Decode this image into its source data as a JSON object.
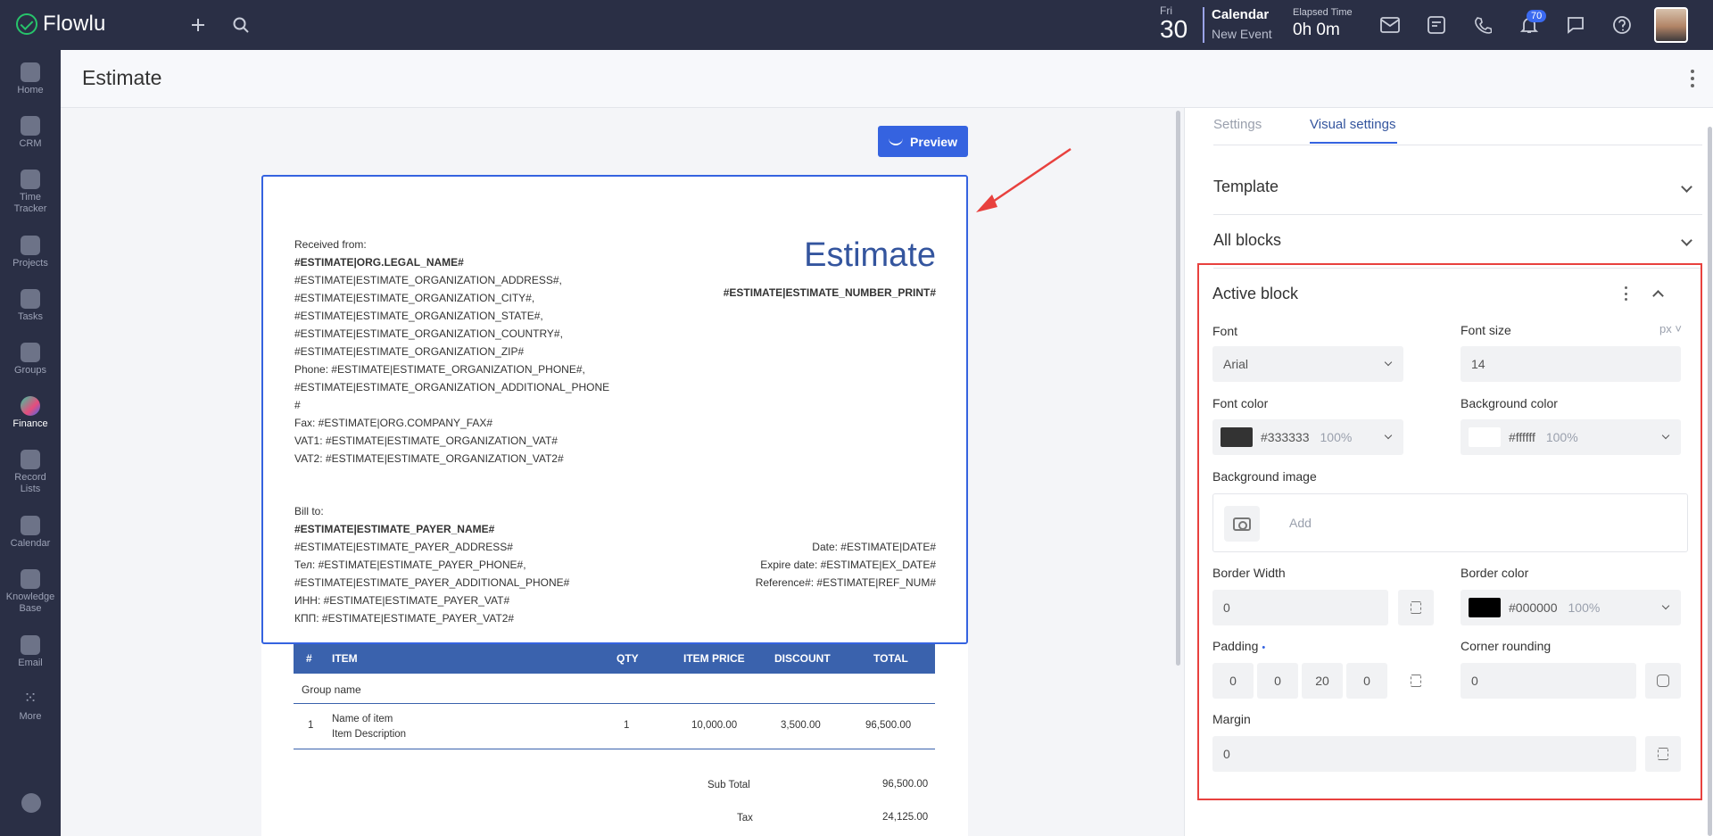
{
  "app": {
    "name": "Flowlu"
  },
  "topbar": {
    "day_name": "Fri",
    "day_num": "30",
    "calendar_title": "Calendar",
    "calendar_sub": "New Event",
    "elapsed_label": "Elapsed Time",
    "elapsed_value": "0h 0m",
    "notif_count": "70"
  },
  "sidebar": {
    "items": [
      {
        "label": "Home"
      },
      {
        "label": "CRM"
      },
      {
        "label": "Time Tracker"
      },
      {
        "label": "Projects"
      },
      {
        "label": "Tasks"
      },
      {
        "label": "Groups"
      },
      {
        "label": "Finance"
      },
      {
        "label": "Record Lists"
      },
      {
        "label": "Calendar"
      },
      {
        "label": "Knowledge Base"
      },
      {
        "label": "Email"
      },
      {
        "label": "More"
      }
    ]
  },
  "page": {
    "title": "Estimate",
    "preview_label": "Preview"
  },
  "document": {
    "title": "Estimate",
    "number": "#ESTIMATE|ESTIMATE_NUMBER_PRINT#",
    "received_from": [
      "Received from:",
      "#ESTIMATE|ORG.LEGAL_NAME#",
      "#ESTIMATE|ESTIMATE_ORGANIZATION_ADDRESS#,",
      "#ESTIMATE|ESTIMATE_ORGANIZATION_CITY#,",
      "#ESTIMATE|ESTIMATE_ORGANIZATION_STATE#,",
      "#ESTIMATE|ESTIMATE_ORGANIZATION_COUNTRY#,",
      "#ESTIMATE|ESTIMATE_ORGANIZATION_ZIP#",
      "Phone: #ESTIMATE|ESTIMATE_ORGANIZATION_PHONE#,",
      "#ESTIMATE|ESTIMATE_ORGANIZATION_ADDITIONAL_PHONE",
      "#",
      "Fax: #ESTIMATE|ORG.COMPANY_FAX#",
      "VAT1: #ESTIMATE|ESTIMATE_ORGANIZATION_VAT#",
      "VAT2: #ESTIMATE|ESTIMATE_ORGANIZATION_VAT2#"
    ],
    "bill_to": [
      "Bill to:",
      "#ESTIMATE|ESTIMATE_PAYER_NAME#",
      "#ESTIMATE|ESTIMATE_PAYER_ADDRESS#",
      "Тел: #ESTIMATE|ESTIMATE_PAYER_PHONE#,",
      "#ESTIMATE|ESTIMATE_PAYER_ADDITIONAL_PHONE#",
      "ИНН: #ESTIMATE|ESTIMATE_PAYER_VAT#",
      "КПП: #ESTIMATE|ESTIMATE_PAYER_VAT2#"
    ],
    "dates": [
      "Date: #ESTIMATE|DATE#",
      "Expire date: #ESTIMATE|EX_DATE#",
      "Reference#: #ESTIMATE|REF_NUM#"
    ],
    "table": {
      "headers": [
        "#",
        "ITEM",
        "QTY",
        "ITEM PRICE",
        "DISCOUNT",
        "TOTAL"
      ],
      "group_name": "Group name",
      "rows": [
        {
          "num": "1",
          "name": "Name of item",
          "desc": "Item Description",
          "qty": "1",
          "price": "10,000.00",
          "discount": "3,500.00",
          "total": "96,500.00"
        }
      ]
    },
    "totals": [
      {
        "label": "Sub Total",
        "value": "96,500.00"
      },
      {
        "label": "Tax",
        "value": "24,125.00"
      }
    ]
  },
  "panel": {
    "tabs": [
      {
        "label": "Settings"
      },
      {
        "label": "Visual settings"
      }
    ],
    "sections": {
      "template": "Template",
      "all_blocks": "All blocks",
      "active_block": "Active block"
    },
    "font": {
      "label": "Font",
      "value": "Arial"
    },
    "font_size": {
      "label": "Font size",
      "unit": "px",
      "value": "14"
    },
    "font_color": {
      "label": "Font color",
      "hex": "#333333",
      "opacity": "100%",
      "swatch": "#333333"
    },
    "background_color": {
      "label": "Background color",
      "hex": "#ffffff",
      "opacity": "100%",
      "swatch": "#ffffff"
    },
    "background_image": {
      "label": "Background image",
      "add_label": "Add"
    },
    "border_width": {
      "label": "Border Width",
      "value": "0"
    },
    "border_color": {
      "label": "Border color",
      "hex": "#000000",
      "opacity": "100%",
      "swatch": "#000000"
    },
    "padding": {
      "label": "Padding",
      "marker": "•",
      "values": [
        "0",
        "0",
        "20",
        "0"
      ]
    },
    "corner_rounding": {
      "label": "Corner rounding",
      "value": "0"
    },
    "margin": {
      "label": "Margin",
      "value": "0"
    }
  },
  "colors": {
    "accent": "#3563e0",
    "highlight": "#e8413e",
    "doc_title": "#34559e",
    "table_header": "#3a62ad"
  }
}
